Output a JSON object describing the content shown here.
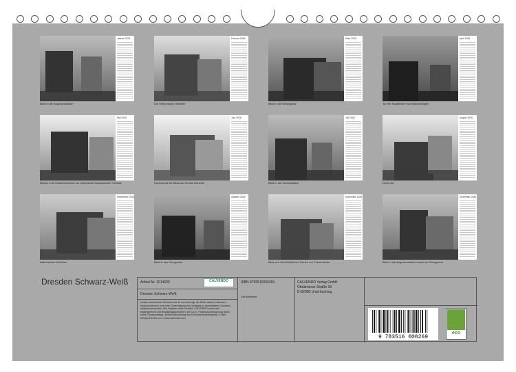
{
  "title": "Dresden Schwarz-Weiß",
  "months": [
    {
      "name": "Januar 2026",
      "caption": "Blick in die Augustusstraße"
    },
    {
      "name": "Februar 2026",
      "caption": "Die Semperoper Dresden"
    },
    {
      "name": "März 2026",
      "caption": "Blick in die Münzgasse"
    },
    {
      "name": "April 2026",
      "caption": "Tor der Staatlichen Kunstsammlungen"
    },
    {
      "name": "Mai 2026",
      "caption": "Brücke vom Residenzschloß zur Kathedrale Sanctissimae Trinitatis"
    },
    {
      "name": "Juni 2026",
      "caption": "Hochschule für Bildende Künste Dresden"
    },
    {
      "name": "Juli 2026",
      "caption": "Blick in die Schloßstraße"
    },
    {
      "name": "August 2026",
      "caption": "Denkmal"
    },
    {
      "name": "September 2026",
      "caption": "Italienisches Dörfchen"
    },
    {
      "name": "Oktober 2026",
      "caption": "Blick in das Georgentor"
    },
    {
      "name": "November 2026",
      "caption": "Blick von den Brühlschen Garten zur Frauenkirche"
    },
    {
      "name": "Dezember 2026",
      "caption": "Blick in die Augustusstraße vorbei am Georgentor"
    }
  ],
  "info": {
    "article": "Artikel-Nr. 2014639",
    "logo": "CALVENDO",
    "product_title": "Dresden Schwarz-Weiß",
    "isbn": "ISBN 9783516000269",
    "author": "Dirk Meutzner",
    "publisher_name": "CALVENDO Verlag GmbH",
    "publisher_street": "Ottobrunner Straße 39",
    "publisher_city": "D-82008 Unterhaching",
    "legal_text": "Inhalte bestehender Schutzrechte ist es untersagt, die Bilder dieses Kalenders herauszutrennen und ohne Genehmigung des Verlages zu gewerblichen Zwecken weiterzuverwenden. Alle Angaben ohne Gewähr. CALVENDO produziert begleitgerecht und klimaklimaatsneutral in DE & EU. Positionsverlängerung durch kurze Transportwege. Abfall-Reduzierung durch Einsatzdruckfertigung. E-Mail: info@calvendo.com • www.calvendo.com",
    "barcode_number": "9 783516 000269",
    "eco_label": "eco"
  },
  "colors": {
    "sheet": "#a9a9a9",
    "eco_green": "#6aa33a"
  }
}
